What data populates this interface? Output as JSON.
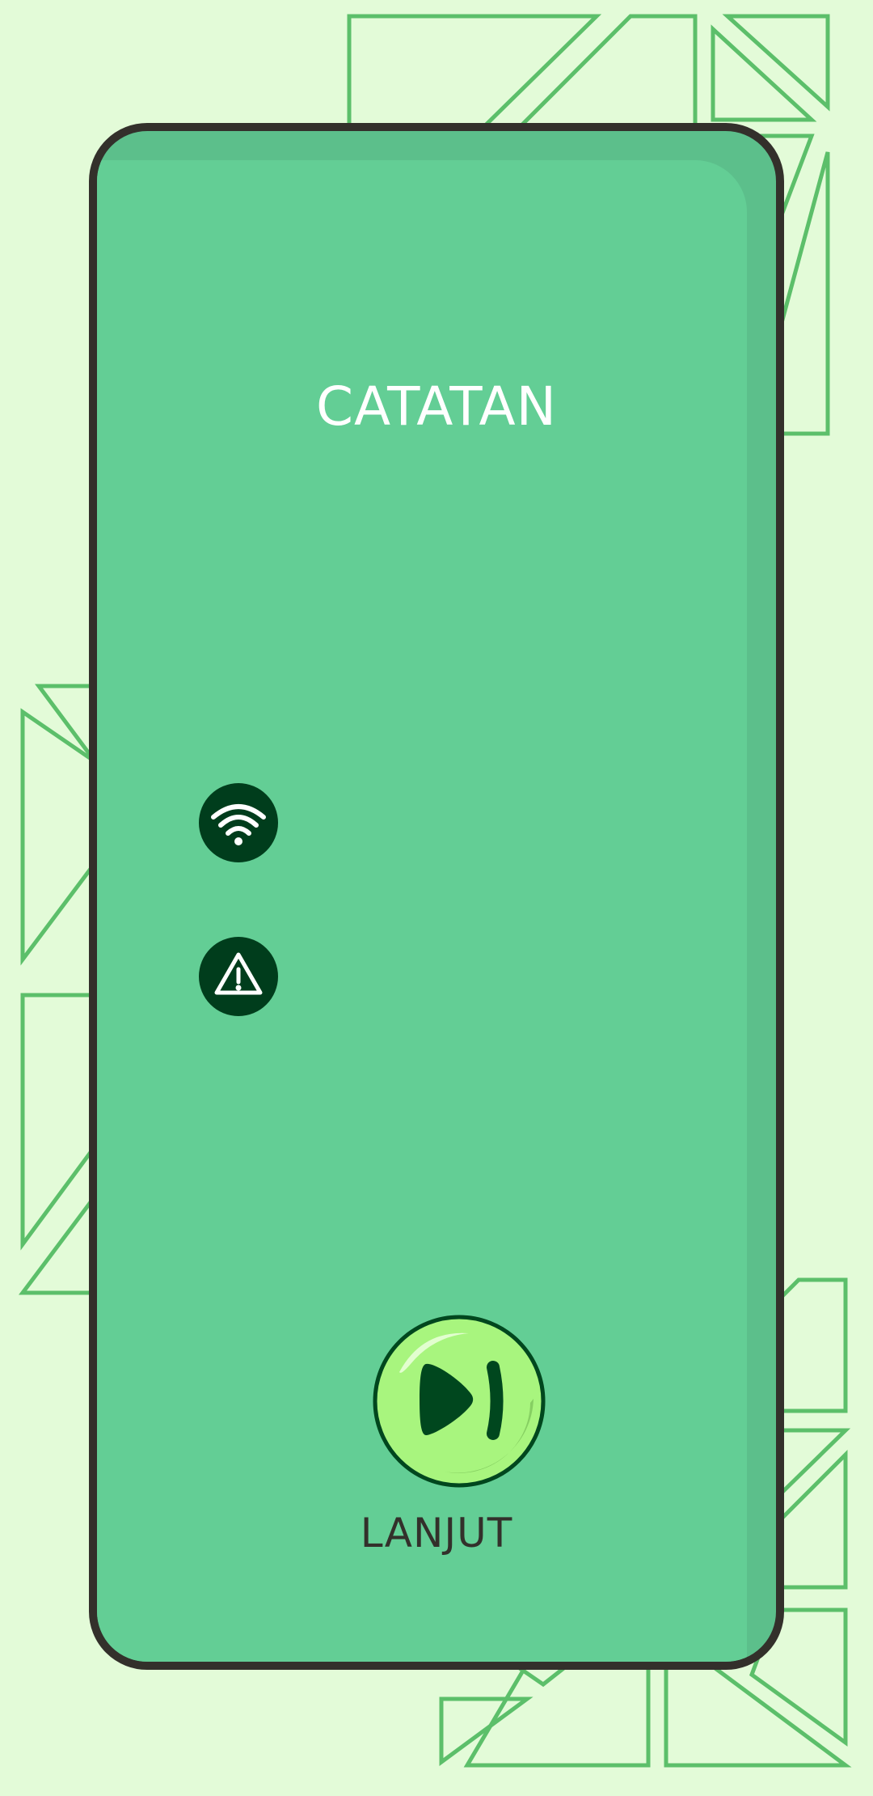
{
  "screen": {
    "title": "CATATAN",
    "next_button": {
      "label": "LANJUT",
      "icon": "play-next-icon"
    },
    "status_icons": [
      {
        "name": "wifi-icon"
      },
      {
        "name": "warning-icon"
      }
    ]
  },
  "colors": {
    "background": "#e3fbd8",
    "decor_stroke": "#5cbf6a",
    "card": "#63ce95",
    "card_shade": "#5cbf8b",
    "card_border": "#33302b",
    "icon_bg": "#003d1c",
    "button_fill": "#a8f57e",
    "button_dark": "#00471e"
  }
}
